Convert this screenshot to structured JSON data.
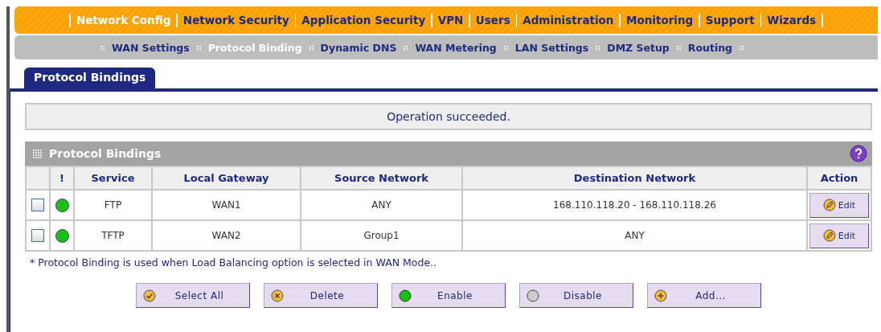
{
  "main_nav": [
    {
      "label": "Network Config",
      "selected": true
    },
    {
      "label": "Network Security",
      "selected": false
    },
    {
      "label": "Application Security",
      "selected": false
    },
    {
      "label": "VPN",
      "selected": false
    },
    {
      "label": "Users",
      "selected": false
    },
    {
      "label": "Administration",
      "selected": false
    },
    {
      "label": "Monitoring",
      "selected": false
    },
    {
      "label": "Support",
      "selected": false
    },
    {
      "label": "Wizards",
      "selected": false
    }
  ],
  "sub_nav": [
    {
      "label": "WAN Settings",
      "selected": false
    },
    {
      "label": "Protocol Binding",
      "selected": true
    },
    {
      "label": "Dynamic DNS",
      "selected": false
    },
    {
      "label": "WAN Metering",
      "selected": false
    },
    {
      "label": "LAN Settings",
      "selected": false
    },
    {
      "label": "DMZ Setup",
      "selected": false
    },
    {
      "label": "Routing",
      "selected": false
    }
  ],
  "page_tab": "Protocol Bindings",
  "message": "Operation succeeded.",
  "section_title": "Protocol Bindings",
  "table": {
    "columns": [
      "!",
      "Service",
      "Local Gateway",
      "Source Network",
      "Destination Network",
      "Action"
    ],
    "rows": [
      {
        "checked": false,
        "enabled": true,
        "service": "FTP",
        "local_gateway": "WAN1",
        "source_network": "ANY",
        "destination_network": "168.110.118.20 - 168.110.118.26",
        "action": "Edit"
      },
      {
        "checked": false,
        "enabled": true,
        "service": "TFTP",
        "local_gateway": "WAN2",
        "source_network": "Group1",
        "destination_network": "ANY",
        "action": "Edit"
      }
    ]
  },
  "footnote": "* Protocol Binding is used when Load Balancing option is selected in WAN Mode..",
  "buttons": [
    {
      "kind": "select-all",
      "label": "Select All"
    },
    {
      "kind": "delete",
      "label": "Delete"
    },
    {
      "kind": "enable",
      "label": "Enable"
    },
    {
      "kind": "disable",
      "label": "Disable"
    },
    {
      "kind": "add",
      "label": "Add..."
    }
  ]
}
